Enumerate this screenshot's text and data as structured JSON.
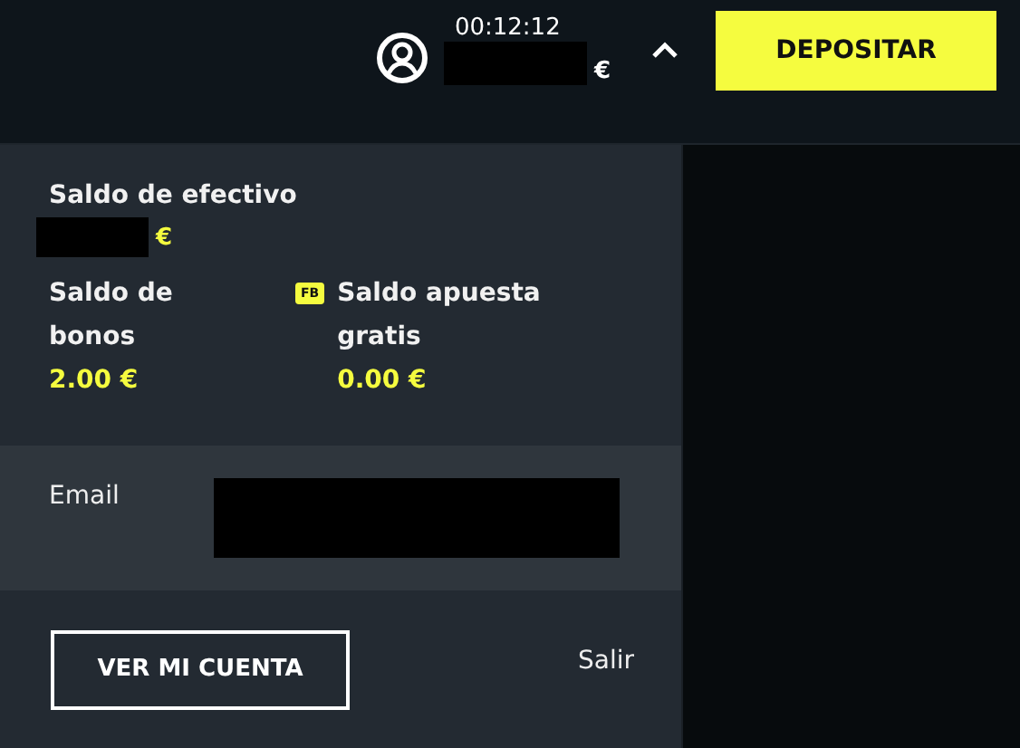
{
  "header": {
    "session_time": "00:12:12",
    "balance_currency": "€",
    "menu_expanded": true,
    "deposit_button": "DEPOSITAR"
  },
  "cash": {
    "label": "Saldo de efectivo",
    "currency": "€"
  },
  "balances": [
    {
      "label": "Saldo de bonos",
      "value": "2.00 €"
    },
    {
      "label": "Saldo apuesta gratis",
      "value": "0.00 €",
      "badge": "FB"
    }
  ],
  "email": {
    "label": "Email"
  },
  "actions": {
    "account_button": "VER MI CUENTA",
    "logout_link": "Salir"
  }
}
